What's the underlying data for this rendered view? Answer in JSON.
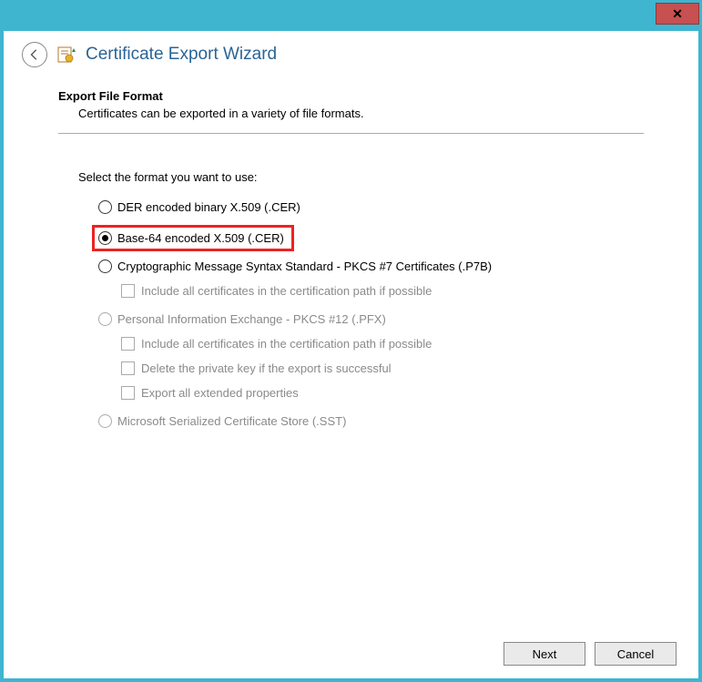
{
  "window": {
    "title": "Certificate Export Wizard"
  },
  "section": {
    "heading": "Export File Format",
    "description": "Certificates can be exported in a variety of file formats."
  },
  "prompt": "Select the format you want to use:",
  "options": {
    "der": "DER encoded binary X.509 (.CER)",
    "base64": "Base-64 encoded X.509 (.CER)",
    "pkcs7": "Cryptographic Message Syntax Standard - PKCS #7 Certificates (.P7B)",
    "pkcs7_include": "Include all certificates in the certification path if possible",
    "pfx": "Personal Information Exchange - PKCS #12 (.PFX)",
    "pfx_include": "Include all certificates in the certification path if possible",
    "pfx_delete": "Delete the private key if the export is successful",
    "pfx_extended": "Export all extended properties",
    "sst": "Microsoft Serialized Certificate Store (.SST)"
  },
  "buttons": {
    "next": "Next",
    "cancel": "Cancel"
  }
}
